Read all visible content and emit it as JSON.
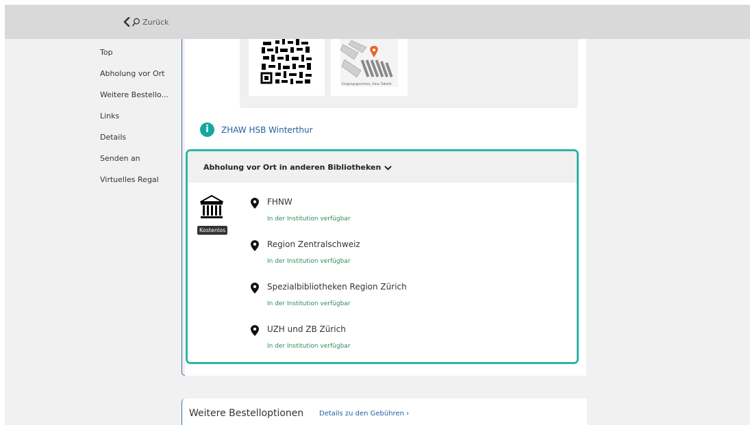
{
  "topbar": {
    "back_label": "Zurück"
  },
  "nav": {
    "items": [
      {
        "label": "Top"
      },
      {
        "label": "Abholung vor Ort"
      },
      {
        "label": "Weitere Bestello..."
      },
      {
        "label": "Links"
      },
      {
        "label": "Details"
      },
      {
        "label": "Senden an"
      },
      {
        "label": "Virtuelles Regal"
      }
    ]
  },
  "location": {
    "library_link": "ZHAW HSB Winterthur",
    "map_caption": "Eingangsgeschoss, Haus Tabelle"
  },
  "pickup": {
    "title": "Abholung vor Ort in anderen Bibliotheken",
    "badge": "Kostenlos",
    "institutions": [
      {
        "name": "FHNW",
        "status": "In der Institution verfügbar"
      },
      {
        "name": "Region Zentralschweiz",
        "status": "In der Institution verfügbar"
      },
      {
        "name": "Spezialbibliotheken Region Zürich",
        "status": "In der Institution verfügbar"
      },
      {
        "name": "UZH und ZB Zürich",
        "status": "In der Institution verfügbar"
      }
    ]
  },
  "options": {
    "title": "Weitere Bestelloptionen",
    "fees_link": "Details zu den Gebühren ›"
  },
  "colors": {
    "accent_teal": "#2bb5a7",
    "link_blue": "#1f5f9e",
    "available_green": "#2e8b57",
    "info_icon": "#12a8a0"
  },
  "icons": [
    "chevron-left-icon",
    "search-icon",
    "info-icon",
    "chevron-down-icon",
    "institution-icon",
    "map-pin-icon"
  ]
}
